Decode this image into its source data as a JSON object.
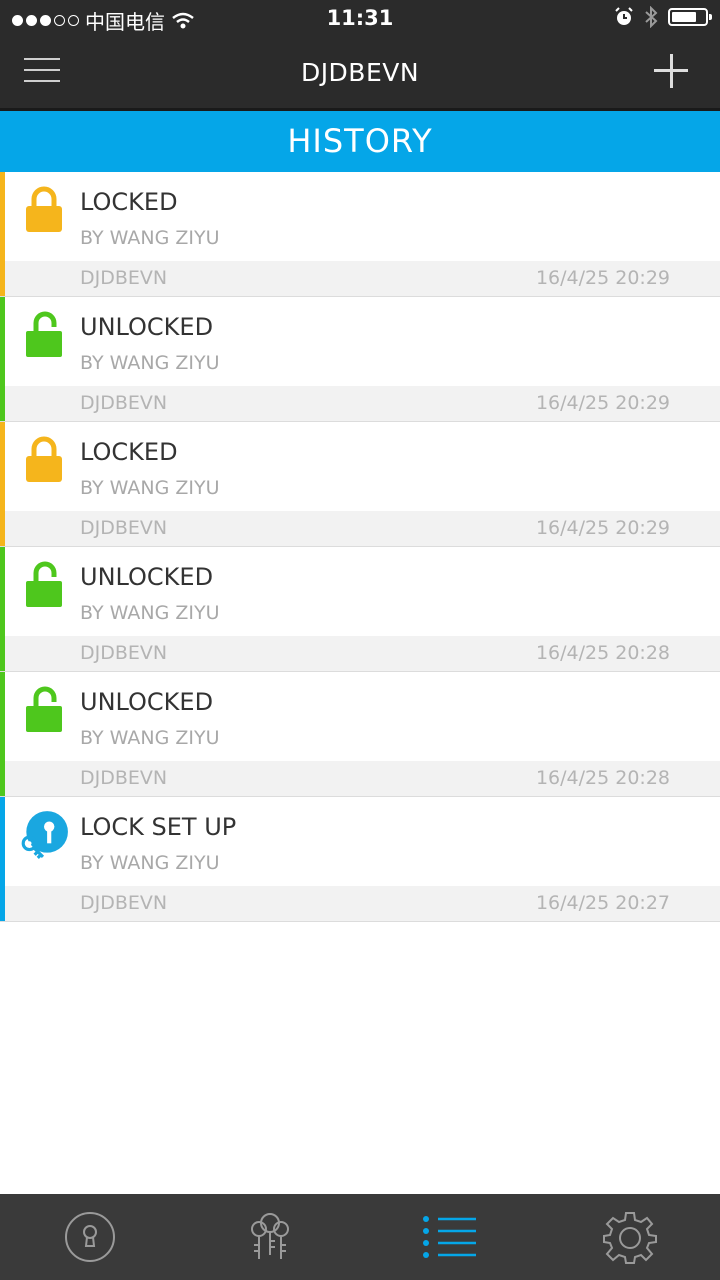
{
  "status_bar": {
    "carrier": "中国电信",
    "time": "11:31"
  },
  "nav": {
    "title": "DJDBEVN",
    "menu_icon": "hamburger-menu-icon",
    "add_icon": "plus-icon"
  },
  "section": {
    "title": "HISTORY"
  },
  "colors": {
    "locked": "#f5b51c",
    "unlocked": "#4ec71d",
    "setup": "#05a6e8",
    "header": "#05a6e8"
  },
  "entries": [
    {
      "action": "LOCKED",
      "actor": "BY WANG ZIYU",
      "lock": "DJDBEVN",
      "time": "16/4/25 20:29",
      "type": "locked"
    },
    {
      "action": "UNLOCKED",
      "actor": "BY WANG ZIYU",
      "lock": "DJDBEVN",
      "time": "16/4/25 20:29",
      "type": "unlocked"
    },
    {
      "action": "LOCKED",
      "actor": "BY WANG ZIYU",
      "lock": "DJDBEVN",
      "time": "16/4/25 20:29",
      "type": "locked"
    },
    {
      "action": "UNLOCKED",
      "actor": "BY WANG ZIYU",
      "lock": "DJDBEVN",
      "time": "16/4/25 20:28",
      "type": "unlocked"
    },
    {
      "action": "UNLOCKED",
      "actor": "BY WANG ZIYU",
      "lock": "DJDBEVN",
      "time": "16/4/25 20:28",
      "type": "unlocked"
    },
    {
      "action": "LOCK SET UP",
      "actor": "BY WANG ZIYU",
      "lock": "DJDBEVN",
      "time": "16/4/25 20:27",
      "type": "setup"
    }
  ],
  "tabs": [
    {
      "icon": "keyhole-lock-icon",
      "active": false
    },
    {
      "icon": "users-keys-icon",
      "active": false
    },
    {
      "icon": "history-list-icon",
      "active": true
    },
    {
      "icon": "gear-icon",
      "active": false
    }
  ]
}
